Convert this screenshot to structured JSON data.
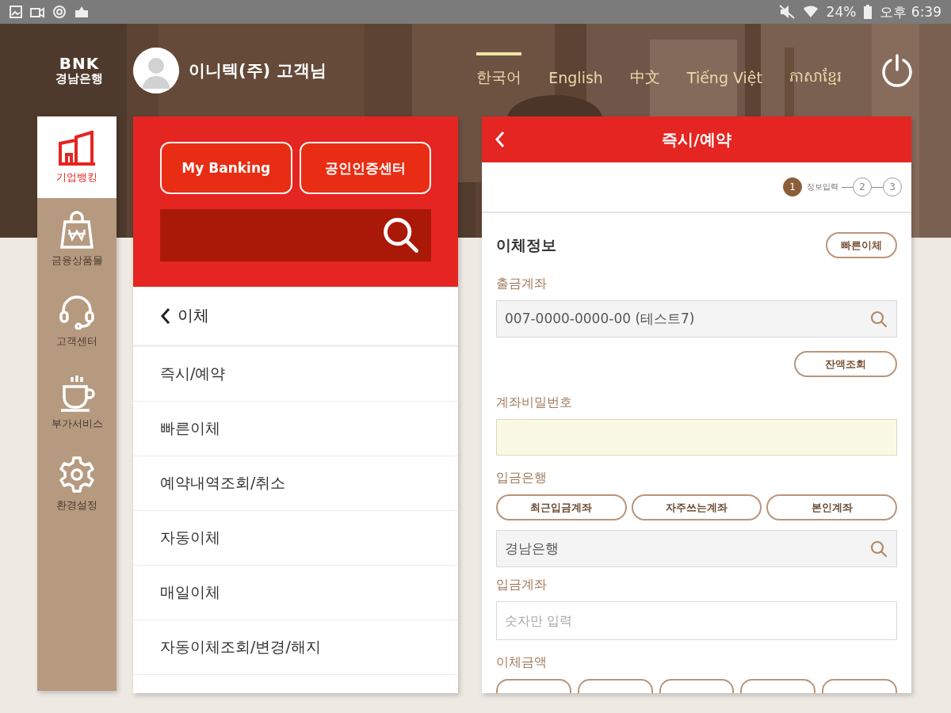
{
  "status_bar": {
    "battery": "24%",
    "time": "오후 6:39"
  },
  "header": {
    "logo_text": "BNK",
    "logo_subtitle": "경남은행",
    "user": "이니텍(주) 고객님",
    "languages": [
      {
        "label": "한국어",
        "selected": true
      },
      {
        "label": "English",
        "selected": false
      },
      {
        "label": "中文",
        "selected": false
      },
      {
        "label": "Tiếng Việt",
        "selected": false
      },
      {
        "label": "ភាសាខ្មែរ",
        "selected": false
      }
    ]
  },
  "nav": [
    {
      "label": "기업뱅킹",
      "kind": "building",
      "selected": true
    },
    {
      "label": "금융상품몰",
      "kind": "bag",
      "selected": false
    },
    {
      "label": "고객센터",
      "kind": "headset",
      "selected": false
    },
    {
      "label": "부가서비스",
      "kind": "cup",
      "selected": false
    },
    {
      "label": "환경설정",
      "kind": "gear",
      "selected": false
    }
  ],
  "menu": {
    "buttons": [
      "My Banking",
      "공인인증센터"
    ],
    "back": "이체",
    "items": [
      "즉시/예약",
      "빠른이체",
      "예약내역조회/취소",
      "자동이체",
      "매일이체",
      "자동이체조회/변경/해지"
    ]
  },
  "form": {
    "title": "즉시/예약",
    "steps": [
      {
        "number": "1",
        "label": "정보입력",
        "selected": true
      },
      {
        "number": "2",
        "selected": false
      },
      {
        "number": "3",
        "selected": false
      }
    ],
    "section": "이체정보",
    "quick_button": "빠른이체",
    "fields": [
      {
        "kind": "label",
        "text": "출금계좌"
      },
      {
        "kind": "select",
        "value": "007-0000-0000-00 (테스트7)"
      },
      {
        "kind": "button",
        "text": "잔액조회"
      },
      {
        "kind": "label",
        "text": "계좌비밀번호"
      },
      {
        "kind": "password"
      },
      {
        "kind": "label",
        "text": "입금은행"
      },
      {
        "kind": "chips",
        "items": [
          "최근입금계좌",
          "자주쓰는계좌",
          "본인계좌"
        ]
      },
      {
        "kind": "select",
        "value": "경남은행"
      },
      {
        "kind": "label",
        "text": "입금계좌"
      },
      {
        "kind": "input",
        "placeholder": "숫자만 입력"
      },
      {
        "kind": "label",
        "text": "이체금액"
      },
      {
        "kind": "cut_chips"
      }
    ]
  }
}
